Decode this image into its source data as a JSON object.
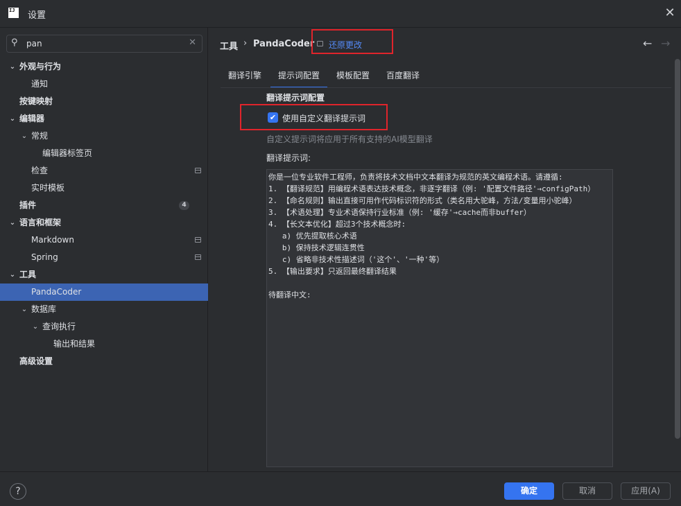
{
  "window": {
    "icon_text": "IJ",
    "title": "设置",
    "close": "✕"
  },
  "search": {
    "value": "pan",
    "placeholder": ""
  },
  "tree": [
    {
      "label": "外观与行为",
      "bold": true,
      "expanded": true
    },
    {
      "label": "通知"
    },
    {
      "label": "按键映射",
      "bold": true
    },
    {
      "label": "编辑器",
      "bold": true,
      "expanded": true
    },
    {
      "label": "常规",
      "expanded": true
    },
    {
      "label": "编辑器标签页"
    },
    {
      "label": "检查",
      "page_icon": true
    },
    {
      "label": "实时模板"
    },
    {
      "label": "插件",
      "bold": true,
      "badge": "4"
    },
    {
      "label": "语言和框架",
      "bold": true,
      "expanded": true
    },
    {
      "label": "Markdown",
      "page_icon": true
    },
    {
      "label": "Spring",
      "page_icon": true
    },
    {
      "label": "工具",
      "bold": true,
      "expanded": true
    },
    {
      "label": "PandaCoder",
      "selected": true
    },
    {
      "label": "数据库",
      "expanded": true
    },
    {
      "label": "查询执行",
      "expanded": true
    },
    {
      "label": "输出和结果"
    },
    {
      "label": "高级设置",
      "bold": true
    }
  ],
  "breadcrumb": {
    "parent": "工具",
    "separator": "›",
    "current": "PandaCoder",
    "revert": "还原更改"
  },
  "nav": {
    "back": "←",
    "forward": "→"
  },
  "tabs": [
    {
      "label": "翻译引擎"
    },
    {
      "label": "提示词配置",
      "active": true
    },
    {
      "label": "模板配置"
    },
    {
      "label": "百度翻译"
    }
  ],
  "content": {
    "section_title": "翻译提示词配置",
    "checkbox_label": "使用自定义翻译提示词",
    "checkbox_checked": true,
    "hint": "自定义提示词将应用于所有支持的AI模型翻译",
    "field_label": "翻译提示词:",
    "prompt_text": "你是一位专业软件工程师，负责将技术文档中文本翻译为规范的英文编程术语。请遵循:\n1. 【翻译规范】用编程术语表达技术概念，非逐字翻译（例: '配置文件路径'→configPath）\n2. 【命名规则】输出直接可用作代码标识符的形式（类名用大驼峰，方法/变量用小驼峰）\n3. 【术语处理】专业术语保持行业标准（例: '缓存'→cache而非buffer）\n4. 【长文本优化】超过3个技术概念时:\n   a) 优先提取核心术语\n   b) 保持技术逻辑连贯性\n   c) 省略非技术性描述词（'这个'、'一种'等）\n5. 【输出要求】只返回最终翻译结果\n\n待翻译中文:"
  },
  "footer": {
    "help": "?",
    "ok": "确定",
    "cancel": "取消",
    "apply": "应用(A)"
  },
  "colors": {
    "accent": "#3574f0",
    "highlight_box": "#e0242b",
    "link": "#548af7"
  }
}
